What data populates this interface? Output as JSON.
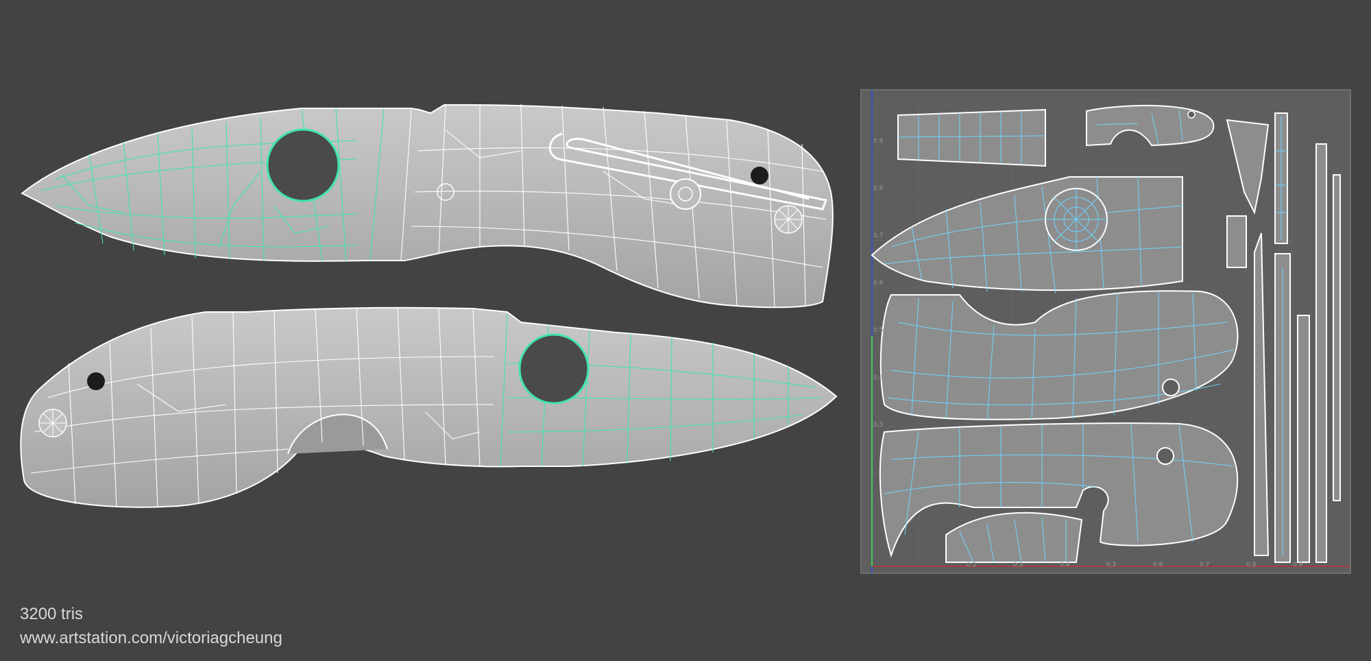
{
  "caption": {
    "triangle_count": "3200 tris",
    "artist_url": "www.artstation.com/victoriagcheung"
  },
  "uv_panel": {
    "u_ticks": [
      "0.2",
      "0.3",
      "0.4",
      "0.5",
      "0.6",
      "0.7",
      "0.8",
      "0.9"
    ],
    "v_ticks": [
      "0.9",
      "0.8",
      "0.7",
      "0.6",
      "0.5",
      "0.4",
      "0.3"
    ]
  },
  "colors": {
    "background": "#434343",
    "mesh_fill": "#b4b4b4",
    "blade_wire": "#3fe6a8",
    "handle_wire": "#ffffff",
    "uv_background": "#5e5e5e",
    "uv_shell_fill": "#8d8d8d",
    "uv_wire": "#6fd6ff"
  }
}
